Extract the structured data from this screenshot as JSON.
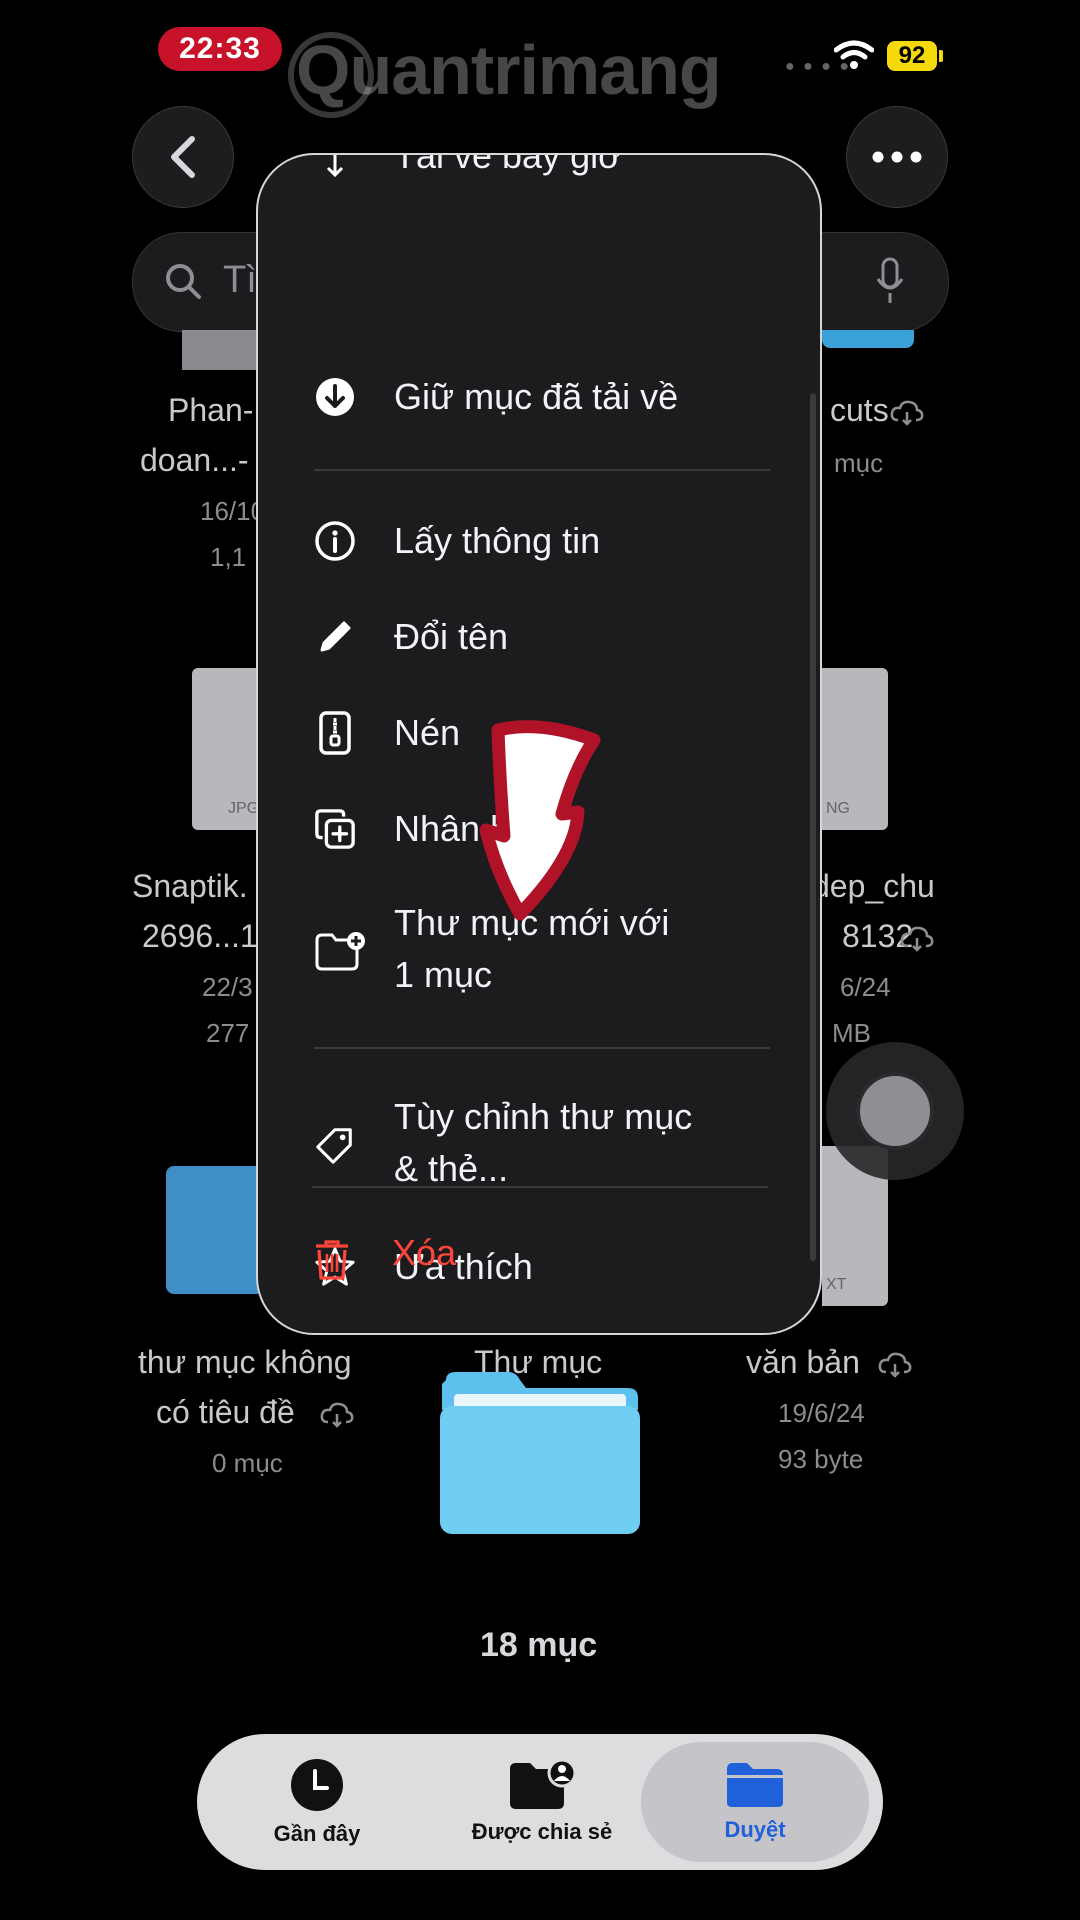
{
  "status": {
    "time": "22:33",
    "battery": "92",
    "watermark": "Quantrimang"
  },
  "search": {
    "placeholder_fragment": "Tì"
  },
  "files": {
    "top_left": {
      "name_l1": "Phan-",
      "name_l2": "doan...-",
      "date": "16/10",
      "size": "1,1"
    },
    "top_right": {
      "name": "cuts",
      "meta": "mục"
    },
    "mid_left": {
      "name_l1": "Snaptik.",
      "name_l2": "2696...1",
      "date": "22/3",
      "size": "277",
      "badge": "JPG"
    },
    "mid_right": {
      "name_l1": "dep_chu",
      "name_l2": "8132",
      "date": "6/24",
      "size": "MB",
      "badge": "NG"
    },
    "bottom_left": {
      "name_l1": "thư mục không",
      "name_l2": "có tiêu đề",
      "meta": "0 mục"
    },
    "bottom_center": {
      "name": "Thư mục"
    },
    "bottom_right": {
      "name": "văn bản",
      "date": "19/6/24",
      "size": "93 byte",
      "badge": "XT"
    }
  },
  "item_count": "18 mục",
  "menu": {
    "top_cut": "Tải về bây giờ",
    "keep_downloaded": "Giữ mục đã tải về",
    "get_info": "Lấy thông tin",
    "rename": "Đổi tên",
    "compress": "Nén",
    "duplicate": "Nhân bản",
    "new_folder_l1": "Thư mục mới với",
    "new_folder_l2": "1 mục",
    "customize_l1": "Tùy chỉnh thư mục",
    "customize_l2": "& thẻ...",
    "favorite": "Ưa thích",
    "delete": "Xóa",
    "delete_color": "#ff453a"
  },
  "tabs": [
    {
      "label": "Gần đây",
      "icon": "clock-icon"
    },
    {
      "label": "Được chia sẻ",
      "icon": "shared-folder-icon"
    },
    {
      "label": "Duyệt",
      "icon": "folder-icon",
      "active": true
    }
  ],
  "colors": {
    "accent": "#2060d8",
    "time_pill": "#c8122a",
    "annotation_arrow": "#b01228"
  }
}
